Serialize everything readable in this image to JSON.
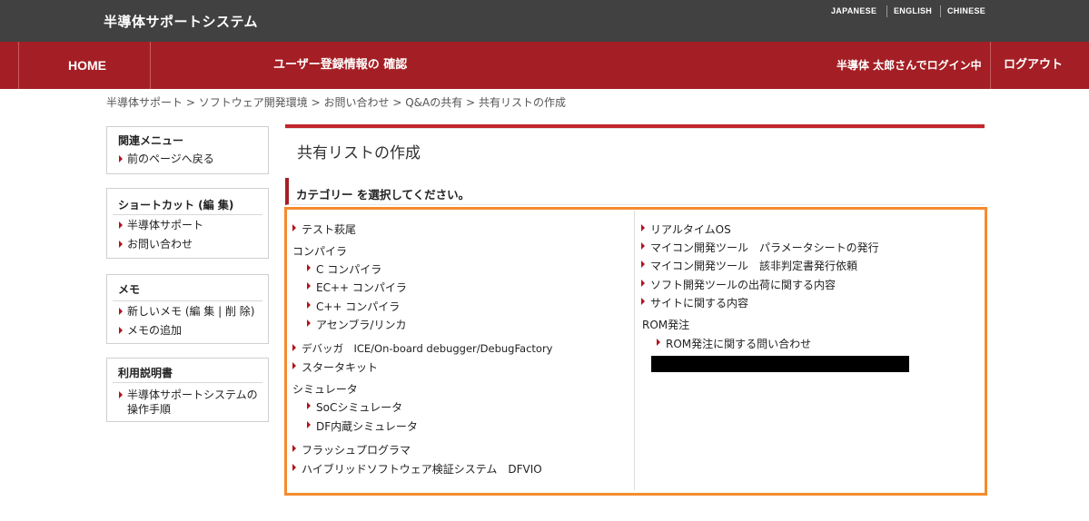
{
  "header": {
    "site_title": "半導体サポートシステム",
    "languages": [
      "JAPANESE",
      "ENGLISH",
      "CHINESE"
    ]
  },
  "nav": {
    "home": "HOME",
    "user_info": "ユーザー登録情報の 確認",
    "login_status": "半導体 太郎さんでログイン中",
    "logout": "ログアウト"
  },
  "breadcrumb": {
    "items": [
      "半導体サポート",
      "ソフトウェア開発環境",
      "お問い合わせ",
      "Q&Aの共有",
      "共有リストの作成"
    ],
    "sep": ">"
  },
  "sidebar": {
    "related": {
      "title": "関連メニュー",
      "items": [
        "前のページへ戻る"
      ]
    },
    "shortcut": {
      "title": "ショートカット (編 集)",
      "items": [
        "半導体サポート",
        "お問い合わせ"
      ]
    },
    "memo": {
      "title": "メモ",
      "items": [
        "新しいメモ (編 集 | 削 除)",
        "メモの追加"
      ]
    },
    "manual": {
      "title": "利用説明書",
      "items": [
        "半導体サポートシステムの",
        "操作手順"
      ]
    }
  },
  "main": {
    "title": "共有リストの作成",
    "instruction": "カテゴリー を選択してください。",
    "left": {
      "test_trial": "テスト萩尾",
      "compiler_group": "コンパイラ",
      "compilers": [
        "C コンパイラ",
        "EC++ コンパイラ",
        "C++ コンパイラ",
        "アセンブラ/リンカ"
      ],
      "debugger": "デバッガ　ICE/On-board debugger/DebugFactory",
      "starter_kit": "スタータキット",
      "simulator_group": "シミュレータ",
      "simulators": [
        "SoCシミュレータ",
        "DF内蔵シミュレータ"
      ],
      "flash": "フラッシュプログラマ",
      "hybrid": "ハイブリッドソフトウェア検証システム　DFVIO"
    },
    "right": {
      "items": [
        "リアルタイムOS",
        "マイコン開発ツール　パラメータシートの発行",
        "マイコン開発ツール　該非判定書発行依頼",
        "ソフト開発ツールの出荷に関する内容",
        "サイトに関する内容"
      ],
      "rom_group": "ROM発注",
      "rom_items": [
        "ROM発注に関する問い合わせ"
      ]
    }
  },
  "colors": {
    "nav_red": "#a41f25",
    "topbar": "#414141",
    "highlight_orange": "#f58b2e",
    "bullet_red": "#b0141c"
  }
}
